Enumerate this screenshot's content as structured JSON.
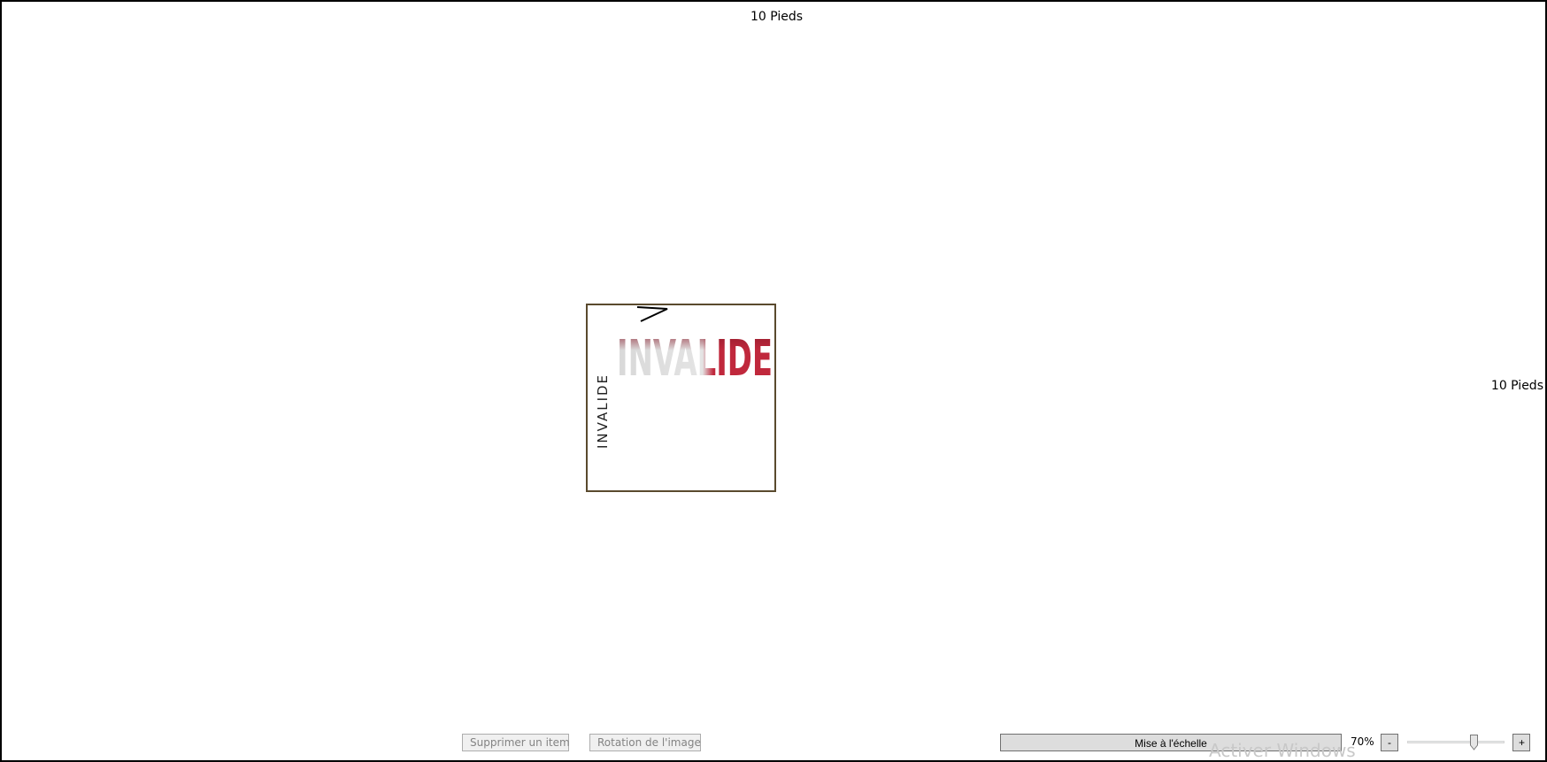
{
  "canvas": {
    "dim_top_label": "10 Pieds",
    "dim_right_label": "10 Pieds"
  },
  "item": {
    "image_text": "INVALIDE",
    "vertical_text": "INVALIDE"
  },
  "toolbar": {
    "delete_label": "Supprimer un item",
    "rotate_label": "Rotation de l'image",
    "scale_label": "Mise à l'échelle",
    "zoom_percent_label": "70%",
    "zoom_minus_label": "-",
    "zoom_plus_label": "+"
  },
  "zoom": {
    "slider_fraction": 0.7
  },
  "system": {
    "watermark": "Activer Windows"
  },
  "colors": {
    "frame_border": "#5a4a2e",
    "invalid_red": "#c0283c",
    "window_border": "#000000"
  }
}
